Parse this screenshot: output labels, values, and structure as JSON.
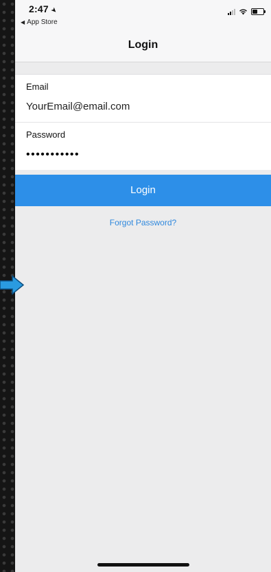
{
  "status_bar": {
    "time": "2:47",
    "location_icon": "location-arrow-icon",
    "back_app_label": "App Store"
  },
  "nav": {
    "title": "Login"
  },
  "form": {
    "email_label": "Email",
    "email_value": "YourEmail@email.com",
    "password_label": "Password",
    "password_value": "•••••••••••"
  },
  "actions": {
    "login_label": "Login",
    "forgot_label": "Forgot Password?"
  },
  "colors": {
    "accent": "#2d8fe8",
    "link": "#2f88dd",
    "background": "#ececed",
    "arrow": "#2a9be0"
  }
}
